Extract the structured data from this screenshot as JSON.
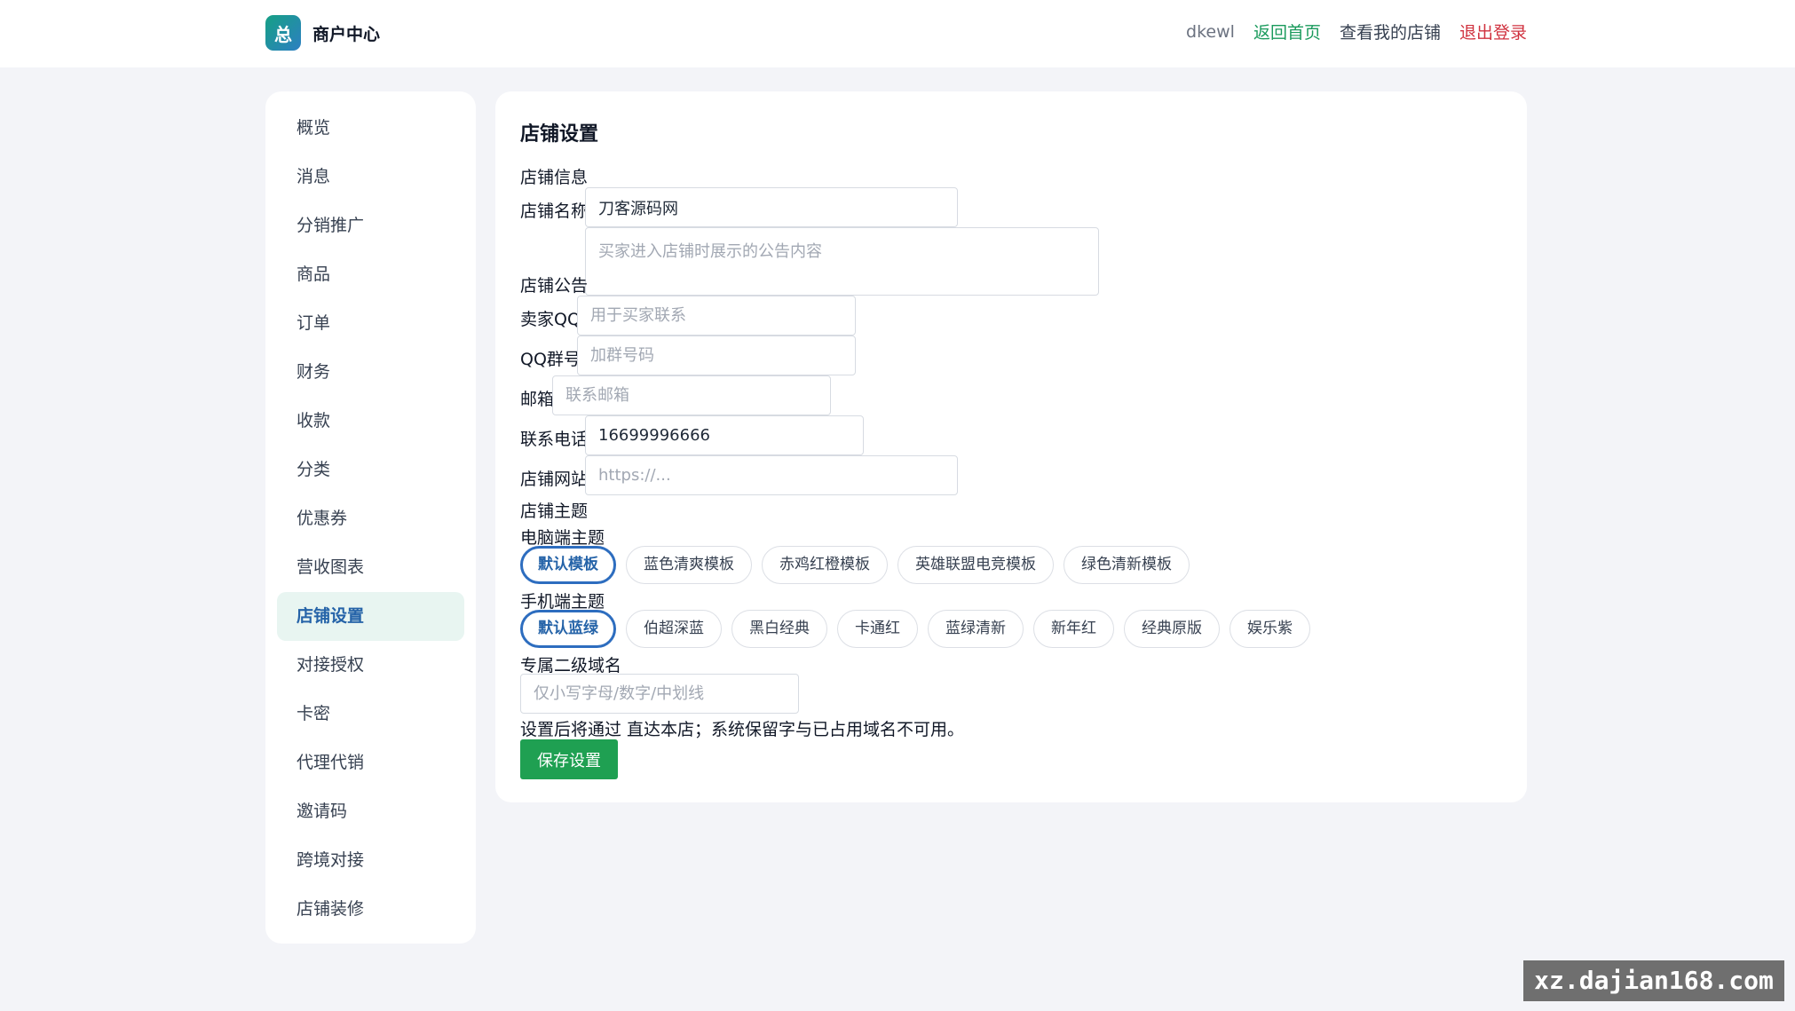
{
  "header": {
    "logo_glyph": "总",
    "title": "商户中心",
    "user": "dkewl",
    "home_link": "返回首页",
    "shop_link": "查看我的店铺",
    "logout_link": "退出登录"
  },
  "sidebar": {
    "items": [
      {
        "label": "概览",
        "active": false
      },
      {
        "label": "消息",
        "active": false
      },
      {
        "label": "分销推广",
        "active": false
      },
      {
        "label": "商品",
        "active": false
      },
      {
        "label": "订单",
        "active": false
      },
      {
        "label": "财务",
        "active": false
      },
      {
        "label": "收款",
        "active": false
      },
      {
        "label": "分类",
        "active": false
      },
      {
        "label": "优惠券",
        "active": false
      },
      {
        "label": "营收图表",
        "active": false
      },
      {
        "label": "店铺设置",
        "active": true
      },
      {
        "label": "对接授权",
        "active": false
      },
      {
        "label": "卡密",
        "active": false
      },
      {
        "label": "代理代销",
        "active": false
      },
      {
        "label": "邀请码",
        "active": false
      },
      {
        "label": "跨境对接",
        "active": false
      },
      {
        "label": "店铺装修",
        "active": false
      }
    ]
  },
  "form": {
    "title": "店铺设置",
    "section_info": "店铺信息",
    "name_label": "店铺名称",
    "name_value": "刀客源码网",
    "notice_label": "店铺公告",
    "notice_placeholder": "买家进入店铺时展示的公告内容",
    "qq_label": "卖家QQ",
    "qq_placeholder": "用于买家联系",
    "qqgroup_label": "QQ群号",
    "qqgroup_placeholder": "加群号码",
    "email_label": "邮箱",
    "email_placeholder": "联系邮箱",
    "phone_label": "联系电话",
    "phone_value": "16699996666",
    "site_label": "店铺网站",
    "site_placeholder": "https://...",
    "section_theme": "店铺主题",
    "pc_theme_label": "电脑端主题",
    "pc_themes": [
      {
        "label": "默认模板",
        "selected": true
      },
      {
        "label": "蓝色清爽模板",
        "selected": false
      },
      {
        "label": "赤鸡红橙模板",
        "selected": false
      },
      {
        "label": "英雄联盟电竞模板",
        "selected": false
      },
      {
        "label": "绿色清新模板",
        "selected": false
      }
    ],
    "mobile_theme_label": "手机端主题",
    "mobile_themes": [
      {
        "label": "默认蓝绿",
        "selected": true
      },
      {
        "label": "伯超深蓝",
        "selected": false
      },
      {
        "label": "黑白经典",
        "selected": false
      },
      {
        "label": "卡通红",
        "selected": false
      },
      {
        "label": "蓝绿清新",
        "selected": false
      },
      {
        "label": "新年红",
        "selected": false
      },
      {
        "label": "经典原版",
        "selected": false
      },
      {
        "label": "娱乐紫",
        "selected": false
      }
    ],
    "subdomain_label": "专属二级域名",
    "subdomain_placeholder": "仅小写字母/数字/中划线",
    "subdomain_hint": "设置后将通过 直达本店；系统保留字与已占用域名不可用。",
    "save_label": "保存设置"
  },
  "watermark": "xz.dajian168.com"
}
